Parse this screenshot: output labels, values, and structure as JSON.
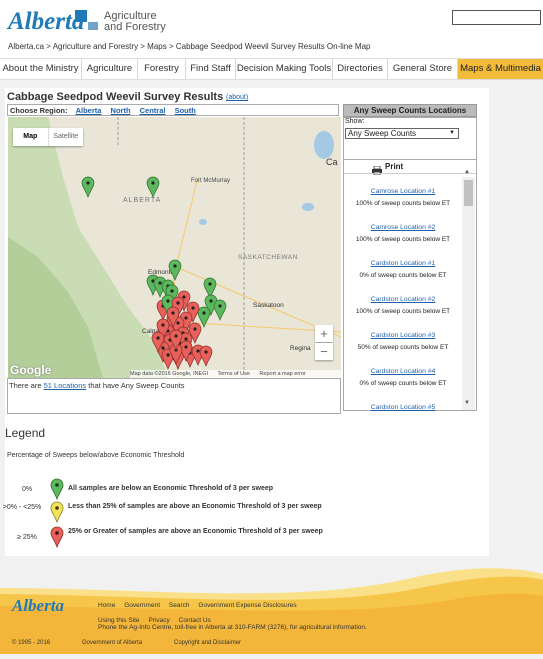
{
  "header": {
    "logo_text": "Alberta",
    "dept_line1": "Agriculture",
    "dept_line2": "and Forestry",
    "search_placeholder": ""
  },
  "breadcrumb": {
    "text": "Alberta.ca > Agriculture and Forestry > Maps > Cabbage Seedpod Weevil Survey Results On-line Map"
  },
  "nav": {
    "items": [
      {
        "label": "About the Ministry"
      },
      {
        "label": "Agriculture"
      },
      {
        "label": "Forestry"
      },
      {
        "label": "Find Staff"
      },
      {
        "label": "Decision Making Tools"
      },
      {
        "label": "Directories"
      },
      {
        "label": "General Store"
      },
      {
        "label": "Maps & Multimedia"
      }
    ]
  },
  "page": {
    "title": "Cabbage Seedpod Weevil Survey Results",
    "about": "(about)",
    "choose_region": "Choose Region:",
    "regions": [
      "Alberta",
      "North",
      "Central",
      "South"
    ]
  },
  "map": {
    "type_map": "Map",
    "type_satellite": "Satellite",
    "zoom_in": "+",
    "zoom_out": "−",
    "google": "Google",
    "attribution": "Map data ©2016 Google, INEGI",
    "terms": "Terms of Use",
    "report": "Report a map error",
    "labels": {
      "fort_mcmurray": "Fort McMurray",
      "alberta": "ALBERTA",
      "edmonton": "Edmonton",
      "saskatchewan": "SASKATCHEWAN",
      "saskatoon": "Saskatoon",
      "calgary": "Calgary",
      "regina": "Regina",
      "ca": "Ca"
    },
    "caption_pre": "There are ",
    "caption_link": "51 Locations",
    "caption_post": " that have Any Sweep Counts"
  },
  "panel": {
    "title": "Any Sweep Counts Locations",
    "show_label": "Show:",
    "show_value": "Any Sweep Counts",
    "print": "Print",
    "locations": [
      {
        "name": "Camrose Location #1",
        "desc": "100% of sweep counts below ET"
      },
      {
        "name": "Camrose Location #2",
        "desc": "100% of sweep counts below ET"
      },
      {
        "name": "Cardston Location #1",
        "desc": "0% of sweep counts below ET"
      },
      {
        "name": "Cardston Location #2",
        "desc": "100% of sweep counts below ET"
      },
      {
        "name": "Cardston Location #3",
        "desc": "50% of sweep counts below ET"
      },
      {
        "name": "Cardston Location #4",
        "desc": "0% of sweep counts below ET"
      },
      {
        "name": "Cardston Location #5",
        "desc": ""
      }
    ]
  },
  "legend": {
    "title": "Legend",
    "subtitle": "Percentage of Sweeps below/above Economic Threshold",
    "rows": [
      {
        "range": "0%",
        "text": "All samples are below an Economic Threshold of 3 per sweep",
        "color": "#5cb85c"
      },
      {
        "range": ">0% - <25%",
        "text": "Less than 25% of samples are above an Economic Threshold of 3 per sweep",
        "color": "#f2e35a"
      },
      {
        "range": "≥ 25%",
        "text": "25% or Greater of samples are above an Economic Threshold of 3 per sweep",
        "color": "#e8605a"
      }
    ]
  },
  "footer": {
    "logo": "Alberta",
    "links1": [
      "Home",
      "Government",
      "Search",
      "Government Expense Disclosures"
    ],
    "links2": [
      "Using this Site",
      "Privacy",
      "Contact Us"
    ],
    "phone": "Phone the Ag-Info Centre, toll-free in Alberta at 310-FARM (3276), for agricultural information.",
    "copyright": "© 1995 - 2016",
    "gov": "Government of Alberta",
    "disclaimer": "Copyright and Disclaimer"
  },
  "colors": {
    "brand_blue": "#1f7ab6",
    "nav_active": "#f2bc3a",
    "marker_green": "#5cb85c",
    "marker_red": "#e8605a"
  }
}
